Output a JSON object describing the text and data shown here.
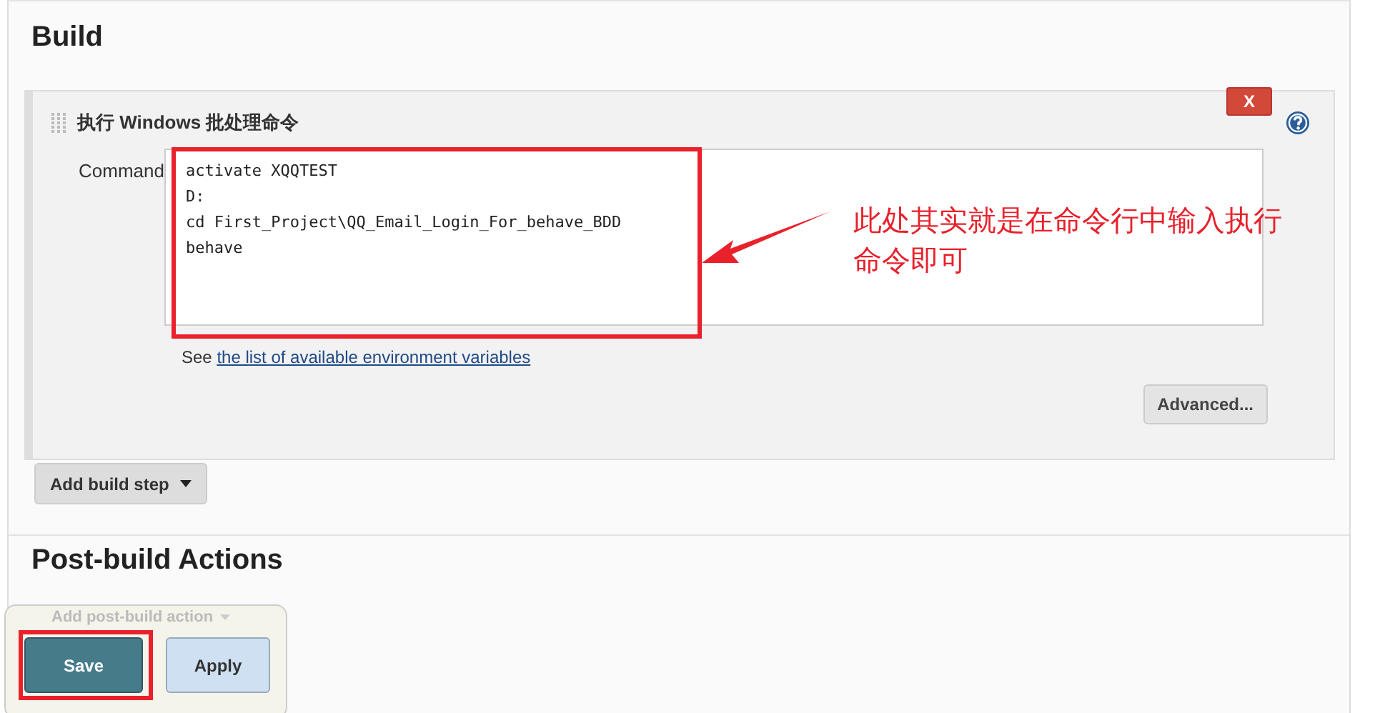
{
  "build": {
    "heading": "Build",
    "step": {
      "title": "执行 Windows 批处理命令",
      "remove_label": "X",
      "command_label": "Command",
      "command": "activate XQQTEST\nD:\ncd First_Project\\QQ_Email_Login_For_behave_BDD\nbehave",
      "hint_prefix": "See",
      "hint_link": "the list of available environment variables",
      "advanced_label": "Advanced..."
    },
    "add_step_label": "Add build step"
  },
  "annotation": {
    "text": "此处其实就是在命令行中输入执行命令即可"
  },
  "post_build": {
    "heading": "Post-build Actions",
    "add_action_label": "Add post-build action"
  },
  "buttons": [
    {
      "kind": "primary",
      "label": "Save",
      "highlighted": true
    },
    {
      "kind": "secondary",
      "label": "Apply",
      "highlighted": false
    }
  ]
}
